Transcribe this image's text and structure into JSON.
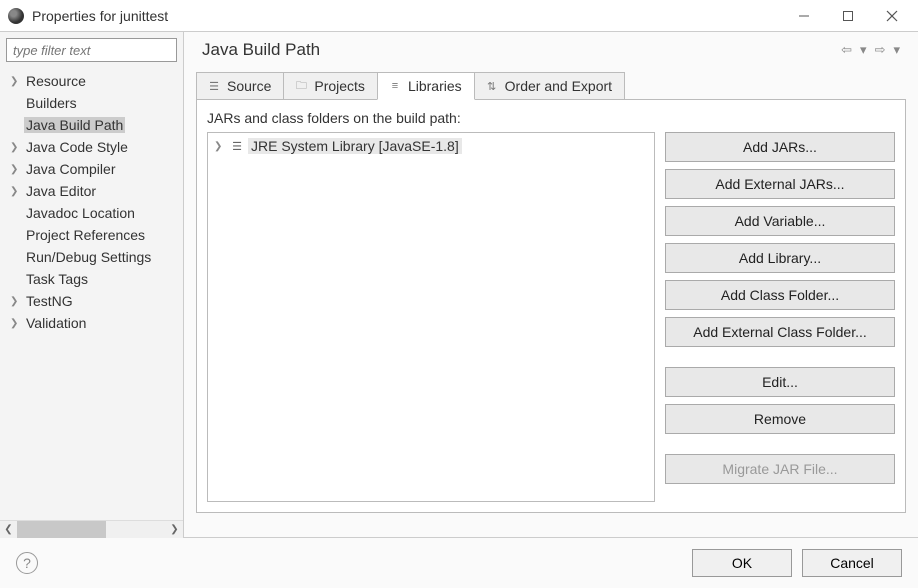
{
  "window": {
    "title": "Properties for junittest"
  },
  "sidebar": {
    "filter_placeholder": "type filter text",
    "items": [
      {
        "label": "Resource",
        "expandable": true
      },
      {
        "label": "Builders",
        "expandable": false
      },
      {
        "label": "Java Build Path",
        "expandable": false,
        "selected": true
      },
      {
        "label": "Java Code Style",
        "expandable": true
      },
      {
        "label": "Java Compiler",
        "expandable": true
      },
      {
        "label": "Java Editor",
        "expandable": true
      },
      {
        "label": "Javadoc Location",
        "expandable": false
      },
      {
        "label": "Project References",
        "expandable": false
      },
      {
        "label": "Run/Debug Settings",
        "expandable": false
      },
      {
        "label": "Task Tags",
        "expandable": false
      },
      {
        "label": "TestNG",
        "expandable": true
      },
      {
        "label": "Validation",
        "expandable": true
      }
    ]
  },
  "content": {
    "heading": "Java Build Path",
    "tabs": [
      {
        "label": "Source",
        "icon": "source-icon"
      },
      {
        "label": "Projects",
        "icon": "projects-icon"
      },
      {
        "label": "Libraries",
        "icon": "libraries-icon",
        "active": true
      },
      {
        "label": "Order and Export",
        "icon": "order-icon"
      }
    ],
    "description": "JARs and class folders on the build path:",
    "lib_entries": [
      {
        "label": "JRE System Library [JavaSE-1.8]",
        "expandable": true
      }
    ],
    "buttons": {
      "add_jars": "Add JARs...",
      "add_ext_jars": "Add External JARs...",
      "add_variable": "Add Variable...",
      "add_library": "Add Library...",
      "add_class_folder": "Add Class Folder...",
      "add_ext_class_folder": "Add External Class Folder...",
      "edit": "Edit...",
      "remove": "Remove",
      "migrate": "Migrate JAR File..."
    }
  },
  "footer": {
    "ok": "OK",
    "cancel": "Cancel"
  }
}
